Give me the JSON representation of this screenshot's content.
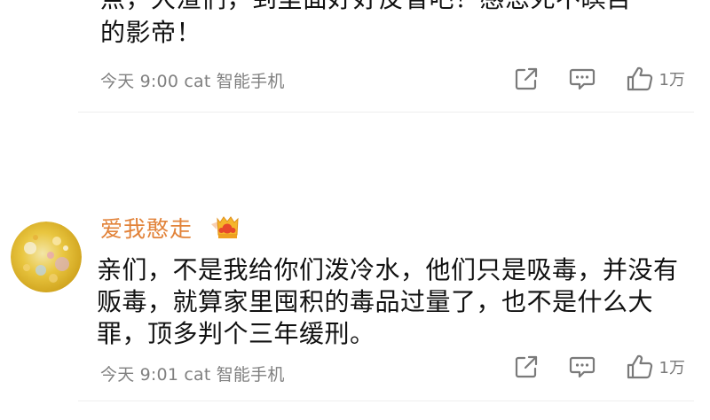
{
  "previous_comment": {
    "text_tail": "点，大渣们，到里面好好反省吧！感恩死不瞑目\n的影帝！",
    "meta": "今天 9:00 cat 智能手机",
    "likes": "1万"
  },
  "comment": {
    "username": "爱我憨走",
    "text": "亲们，不是我给你们泼冷水，他们只是吸毒，并没有贩毒，就算家里囤积的毒品过量了，也不是什么大罪，顶多判个三年缓刑。",
    "meta": "今天 9:01 cat 智能手机",
    "likes": "1万"
  },
  "icons": {
    "share": "share-icon",
    "reply": "comment-icon",
    "like": "thumbs-up-icon",
    "badge": "crown-badge-icon"
  },
  "colors": {
    "username": "#e2833a",
    "meta": "#808080",
    "icon": "#7a7a7a",
    "badge": "#f0a020"
  }
}
